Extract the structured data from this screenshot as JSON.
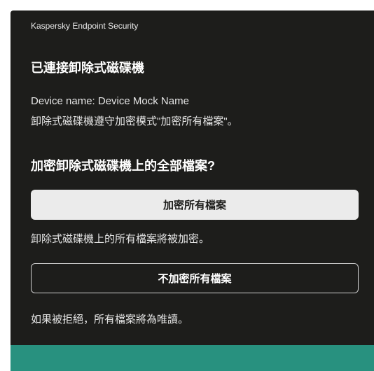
{
  "window": {
    "app_title": "Kaspersky Endpoint Security"
  },
  "dialog": {
    "heading": "已連接卸除式磁碟機",
    "device_name": "Device name: Device Mock Name",
    "mode_text": "卸除式磁碟機遵守加密模式\"加密所有檔案\"。",
    "question": "加密卸除式磁碟機上的全部檔案?",
    "encrypt_button": "加密所有檔案",
    "encrypt_note": "卸除式磁碟機上的所有檔案將被加密。",
    "skip_button": "不加密所有檔案",
    "skip_note": "如果被拒絕，所有檔案將為唯讀。"
  },
  "colors": {
    "window_bg": "#1d1d1b",
    "primary_button_bg": "#ebebeb",
    "accent_footer": "#28917f"
  }
}
